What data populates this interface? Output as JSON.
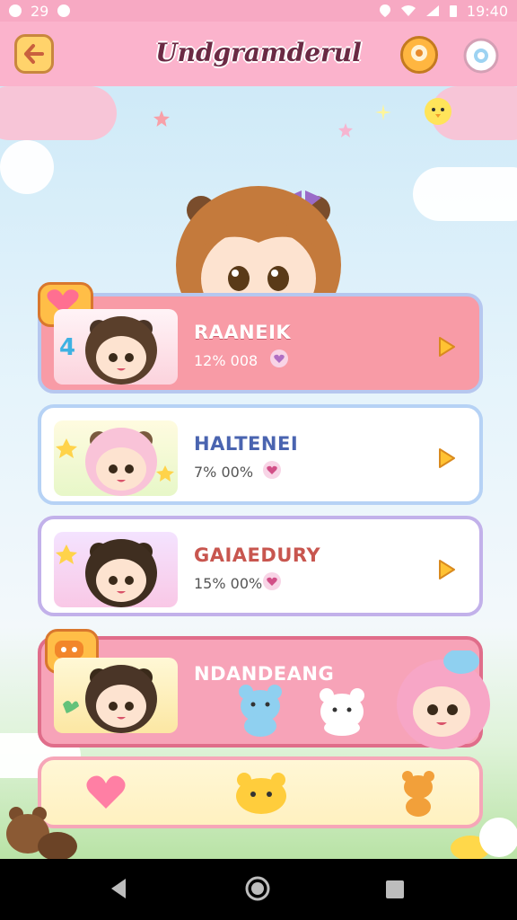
{
  "statusbar": {
    "left_text": "29",
    "time": "19:40"
  },
  "appbar": {
    "title": "Undgramderul"
  },
  "cards": [
    {
      "name": "RAANEIK",
      "stat": "12% 008",
      "badge": "4"
    },
    {
      "name": "HALTENEI",
      "stat": "7% 00%"
    },
    {
      "name": "GAIAEDURY",
      "stat": "15% 00%"
    },
    {
      "name": "NDANDEANG",
      "stat": ""
    }
  ],
  "colors": {
    "appbar": "#fbb3cc",
    "card1": "#f89ba6",
    "card2": "#ffffff",
    "card3": "#ffffff",
    "card4": "#f7a3b8"
  }
}
